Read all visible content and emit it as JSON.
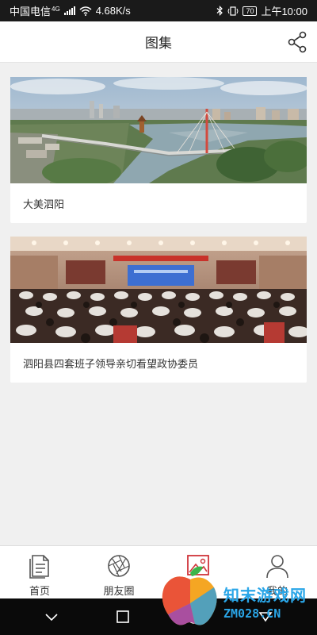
{
  "status_bar": {
    "carrier": "中国电信",
    "network": "4G",
    "speed": "4.68K/s",
    "battery": "70",
    "time": "上午10:00"
  },
  "header": {
    "title": "图集",
    "share_icon": "share-icon"
  },
  "gallery": [
    {
      "caption": "大美泗阳",
      "image": "aerial-city-bridge-photo"
    },
    {
      "caption": "泗阳县四套班子领导亲切看望政协委员",
      "image": "conference-hall-photo"
    }
  ],
  "tab_bar": {
    "active": "图集",
    "items": [
      {
        "label": "首页",
        "icon": "document-icon"
      },
      {
        "label": "朋友圈",
        "icon": "aperture-icon"
      },
      {
        "label": "图集",
        "icon": "image-icon"
      },
      {
        "label": "我的",
        "icon": "user-icon"
      }
    ]
  },
  "nav_bar": {
    "buttons": [
      "back-icon",
      "home-square-icon",
      "home-circle-icon",
      "notifications-icon"
    ]
  },
  "watermark": {
    "line1": "知末游戏网",
    "line2": "ZM028.CN"
  },
  "colors": {
    "accent": "#d0343a",
    "watermark": "#2aa6e8"
  }
}
